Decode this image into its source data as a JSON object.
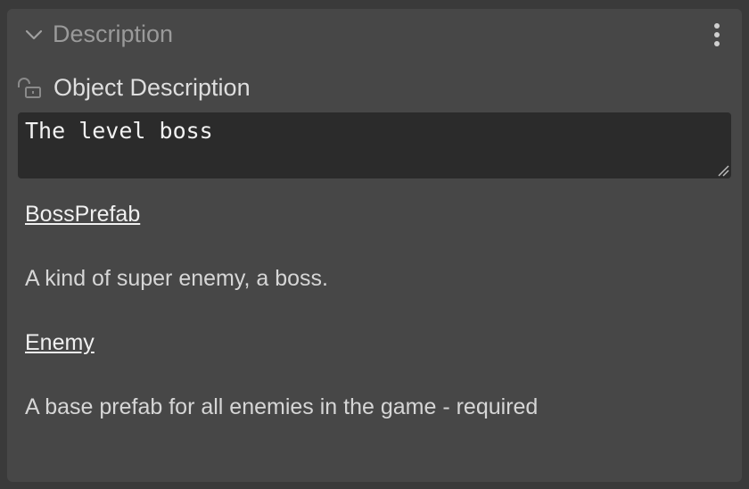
{
  "panel": {
    "title": "Description",
    "chevron_icon": "chevron-down-icon",
    "menu_icon": "kebab-menu-icon"
  },
  "property": {
    "label": "Object Description",
    "lock_icon": "unlock-icon",
    "value": "The level boss"
  },
  "entries": [
    {
      "name": "BossPrefab",
      "description": "A kind of super enemy, a boss."
    },
    {
      "name": "Enemy",
      "description": "A base prefab for all enemies in the game - required"
    }
  ],
  "colors": {
    "panel_bg": "#474747",
    "outer_bg": "#3a3a3a",
    "field_bg": "#2b2b2b",
    "header_text": "#9a9a9a",
    "text": "#dedede"
  }
}
